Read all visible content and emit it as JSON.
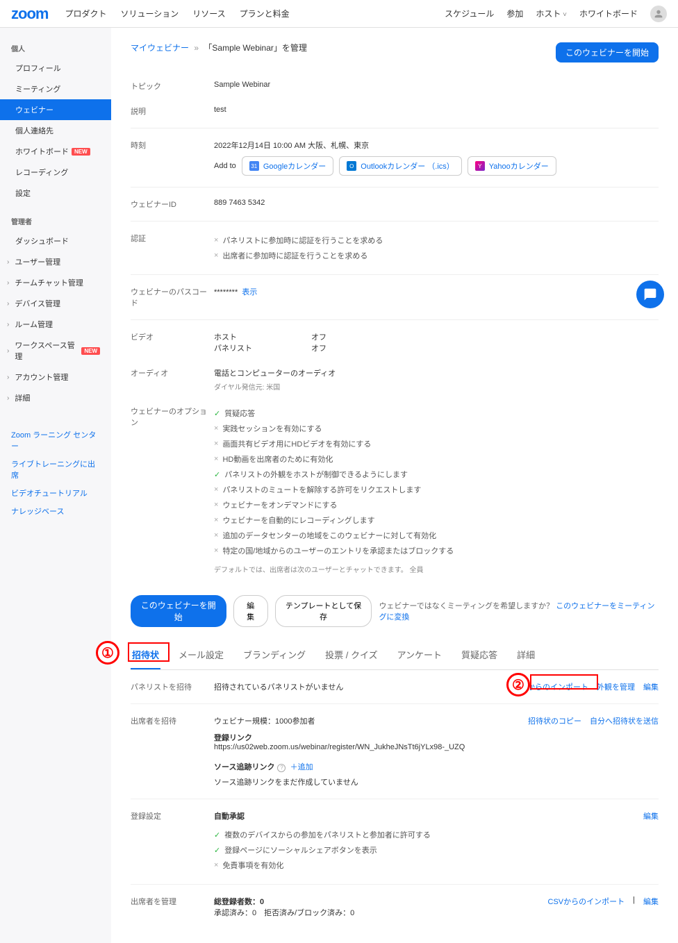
{
  "header": {
    "logo": "zoom",
    "nav": [
      "プロダクト",
      "ソリューション",
      "リソース",
      "プランと料金"
    ],
    "rightNav": [
      "スケジュール",
      "参加",
      "ホスト",
      "ホワイトボード"
    ]
  },
  "sidebar": {
    "personal_heading": "個人",
    "admin_heading": "管理者",
    "personal": [
      {
        "label": "プロフィール"
      },
      {
        "label": "ミーティング"
      },
      {
        "label": "ウェビナー",
        "active": true
      },
      {
        "label": "個人連絡先"
      },
      {
        "label": "ホワイトボード",
        "badge": "NEW"
      },
      {
        "label": "レコーディング"
      },
      {
        "label": "設定"
      }
    ],
    "admin": [
      {
        "label": "ダッシュボード"
      },
      {
        "label": "ユーザー管理",
        "exp": true
      },
      {
        "label": "チームチャット管理",
        "exp": true
      },
      {
        "label": "デバイス管理",
        "exp": true
      },
      {
        "label": "ルーム管理",
        "exp": true
      },
      {
        "label": "ワークスペース管理",
        "exp": true,
        "badge": "NEW"
      },
      {
        "label": "アカウント管理",
        "exp": true
      },
      {
        "label": "詳細",
        "exp": true
      }
    ],
    "links": [
      "Zoom ラーニング センター",
      "ライブトレーニングに出席",
      "ビデオチュートリアル",
      "ナレッジベース"
    ]
  },
  "breadcrumb": {
    "root": "マイウェビナー",
    "sep": "»",
    "current": "「Sample Webinar」を管理"
  },
  "buttons": {
    "start_webinar": "このウェビナーを開始",
    "edit": "編集",
    "save_template": "テンプレートとして保存",
    "show": "表示",
    "add": "＋追加"
  },
  "details": {
    "topic_label": "トピック",
    "topic_value": "Sample Webinar",
    "desc_label": "説明",
    "desc_value": "test",
    "time_label": "時刻",
    "time_value": "2022年12月14日 10:00 AM 大阪、札幌、東京",
    "addto_label": "Add to",
    "cal_google": "Googleカレンダー",
    "cal_outlook": "Outlookカレンダー （.ics）",
    "cal_yahoo": "Yahooカレンダー",
    "id_label": "ウェビナーID",
    "id_value": "889 7463 5342",
    "auth_label": "認証",
    "auth_opt1": "パネリストに参加時に認証を行うことを求める",
    "auth_opt2": "出席者に参加時に認証を行うことを求める",
    "pass_label": "ウェビナーのパスコード",
    "pass_value": "********",
    "video_label": "ビデオ",
    "host_label": "ホスト",
    "host_value": "オフ",
    "panelist_label": "パネリスト",
    "panelist_value": "オフ",
    "audio_label": "オーディオ",
    "audio_value": "電話とコンピューターのオーディオ",
    "audio_sub": "ダイヤル発信元: 米国",
    "options_label": "ウェビナーのオプション",
    "options": [
      {
        "on": true,
        "text": "質疑応答"
      },
      {
        "on": false,
        "text": "実践セッションを有効にする"
      },
      {
        "on": false,
        "text": "画面共有ビデオ用にHDビデオを有効にする"
      },
      {
        "on": false,
        "text": "HD動画を出席者のために有効化"
      },
      {
        "on": true,
        "text": "パネリストの外観をホストが制御できるようにします"
      },
      {
        "on": false,
        "text": "パネリストのミュートを解除する許可をリクエストします"
      },
      {
        "on": false,
        "text": "ウェビナーをオンデマンドにする"
      },
      {
        "on": false,
        "text": "ウェビナーを自動的にレコーディングします"
      },
      {
        "on": false,
        "text": "追加のデータセンターの地域をこのウェビナーに対して有効化"
      },
      {
        "on": false,
        "text": "特定の国/地域からのユーザーのエントリを承認またはブロックする"
      }
    ],
    "options_footer": "デフォルトでは、出席者は次のユーザーとチャットできます。 全員"
  },
  "convert": {
    "text": "ウェビナーではなくミーティングを希望しますか？",
    "link": "このウェビナーをミーティングに変換"
  },
  "tabs": [
    "招待状",
    "メール設定",
    "ブランディング",
    "投票 / クイズ",
    "アンケート",
    "質疑応答",
    "詳細"
  ],
  "invite": {
    "panelist_label": "パネリストを招待",
    "panelist_empty": "招待されているパネリストがいません",
    "csv_import": "CSVからのインポート",
    "manage_appearance": "外観を管理",
    "edit": "編集",
    "attendee_label": "出席者を招待",
    "scale": "ウェビナー規模：1000参加者",
    "reg_link_label": "登録リンク",
    "reg_link": "https://us02web.zoom.us/webinar/register/WN_JukheJNsTt6jYLx98-_UZQ",
    "copy_invite": "招待状のコピー",
    "send_invite": "自分へ招待状を送信",
    "tracking_label": "ソース追跡リンク",
    "tracking_empty": "ソース追跡リンクをまだ作成していません"
  },
  "reg": {
    "label": "登録設定",
    "auto_approve": "自動承認",
    "opt1": "複数のデバイスからの参加をパネリストと参加者に許可する",
    "opt2": "登録ページにソーシャルシェアボタンを表示",
    "opt3": "免責事項を有効化",
    "edit": "編集"
  },
  "manage": {
    "label": "出席者を管理",
    "total": "総登録者数：0",
    "detail": "承認済み：0　拒否済み/ブロック済み：0",
    "csv_import": "CSVからのインポート",
    "edit": "編集"
  }
}
